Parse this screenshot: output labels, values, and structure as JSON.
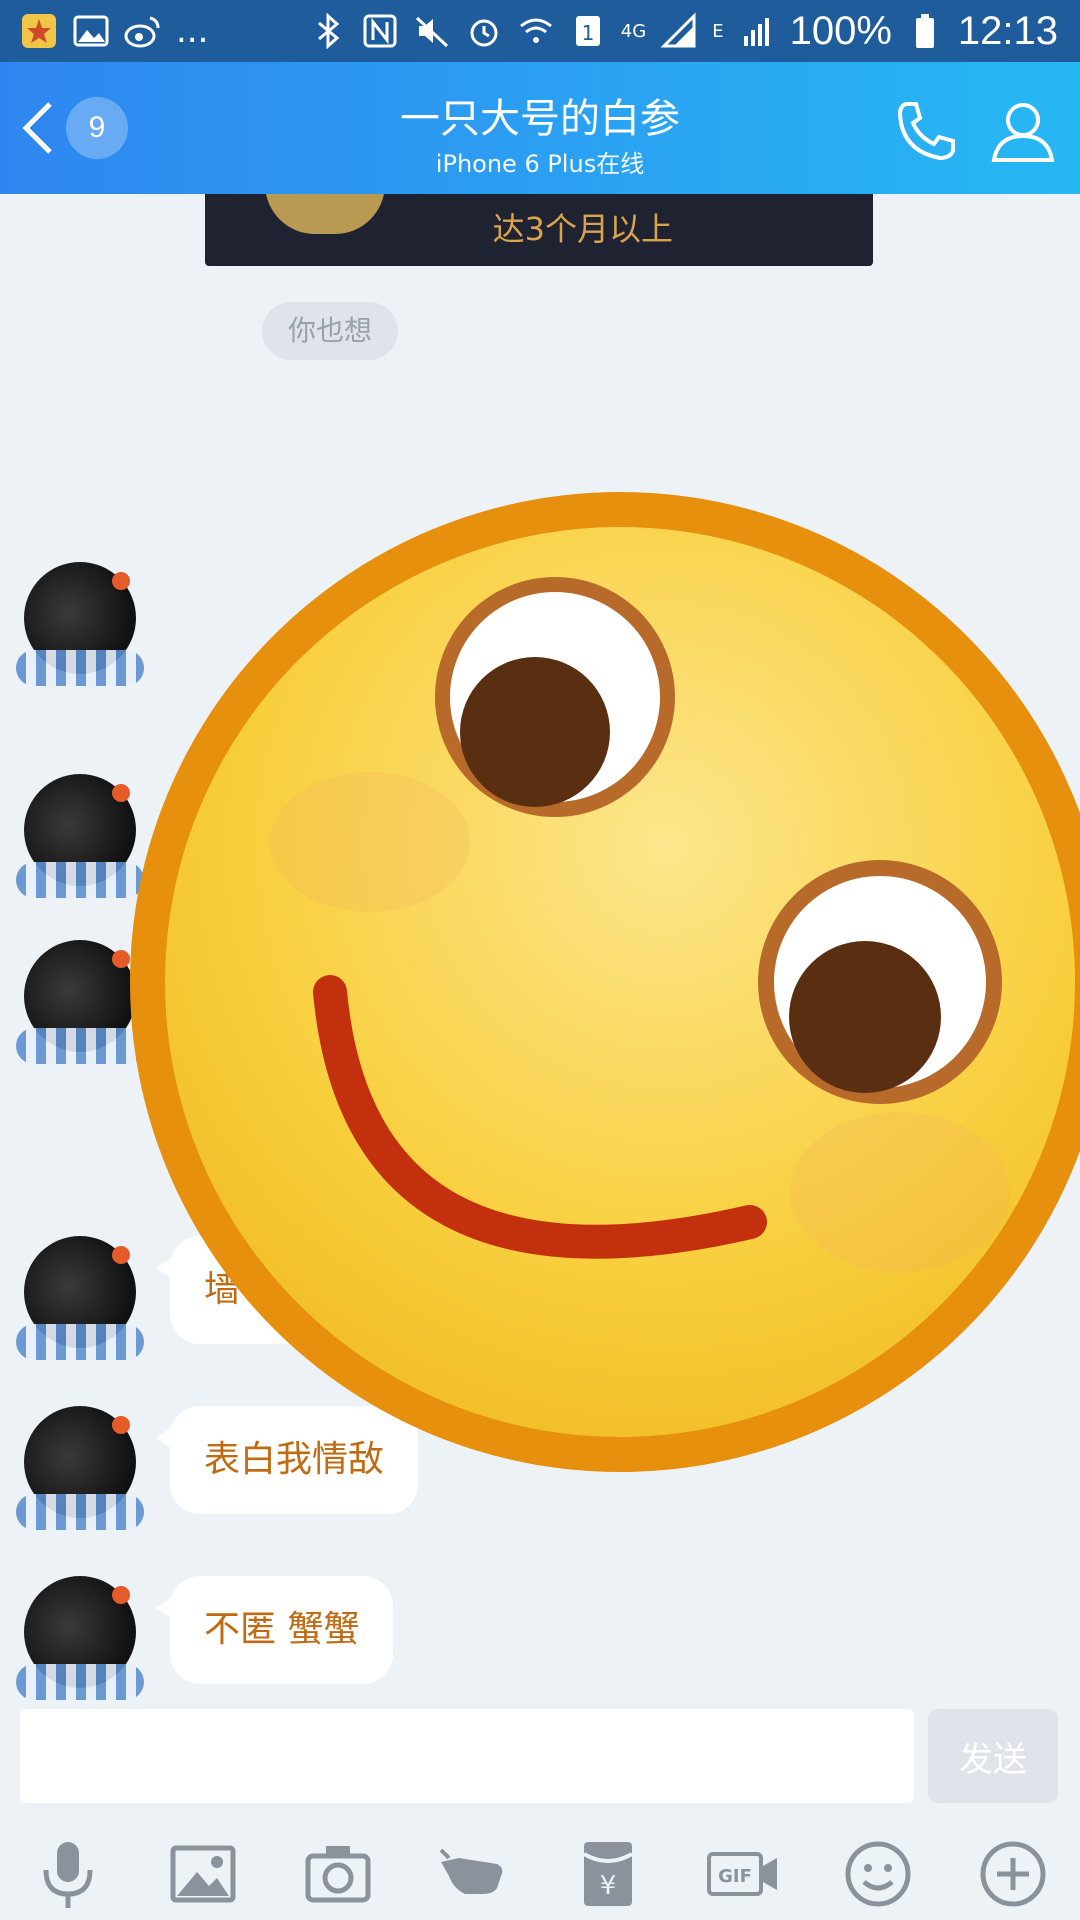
{
  "status_bar": {
    "time": "12:13",
    "battery": "100%",
    "network": "4G",
    "network2": "E",
    "more": "..."
  },
  "header": {
    "back_count": "9",
    "title": "一只大号的白参",
    "subtitle": "iPhone 6 Plus在线"
  },
  "chat": {
    "card_text": "达3个月以上",
    "system_pill": "你也想",
    "messages": [
      {
        "text": "墙 表白202003彭琪迪"
      },
      {
        "text": "表白我情敌"
      },
      {
        "text": "不匿 蟹蟹"
      }
    ]
  },
  "input": {
    "placeholder": "",
    "send_label": "发送"
  },
  "colors": {
    "title_gradient_start": "#2f86f0",
    "title_gradient_end": "#27b8f3",
    "bubble_text": "#c06b12",
    "background": "#edf2f6"
  },
  "icons": [
    "microphone-icon",
    "image-icon",
    "camera-icon",
    "poke-icon",
    "red-packet-icon",
    "gif-icon",
    "emoji-icon",
    "plus-icon"
  ]
}
